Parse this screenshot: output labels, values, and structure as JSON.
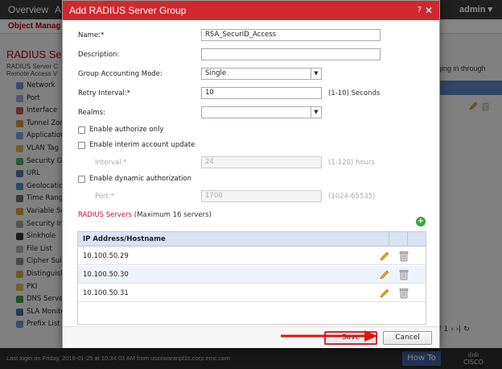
{
  "background": {
    "nav": [
      "Overview",
      "A"
    ],
    "admin": "admin ▾",
    "subnav": "Object Manag",
    "page_title": "RADIUS Ser",
    "page_sub_1": "RADIUS Server C",
    "page_sub_2": "Remote Access V",
    "right_text": "ogging in through",
    "pager": "of 1  ›  ›|  ↻",
    "sidebar": [
      {
        "label": "Network",
        "color": "#6b8fc9"
      },
      {
        "label": "Port",
        "color": "#8aa6d6"
      },
      {
        "label": "Interface",
        "color": "#c95050"
      },
      {
        "label": "Tunnel Zon",
        "color": "#d08a3a"
      },
      {
        "label": "Application",
        "color": "#7b9bd0"
      },
      {
        "label": "VLAN Tag",
        "color": "#d0b050"
      },
      {
        "label": "Security G",
        "color": "#5aa05a"
      },
      {
        "label": "URL",
        "color": "#4a70b0"
      },
      {
        "label": "Geolocation",
        "color": "#4a8fb0"
      },
      {
        "label": "Time Rang",
        "color": "#6a6a6a"
      },
      {
        "label": "Variable Se",
        "color": "#d09a30"
      },
      {
        "label": "Security In",
        "color": "#9a9a9a"
      },
      {
        "label": "Sinkhole",
        "color": "#333333"
      },
      {
        "label": "File List",
        "color": "#aaaaaa"
      },
      {
        "label": "Cipher Sui",
        "color": "#888888"
      },
      {
        "label": "Distinguish",
        "color": "#c8a040"
      },
      {
        "label": "PKI",
        "color": "#d0b060"
      },
      {
        "label": "DNS Serve",
        "color": "#4a8a4a"
      },
      {
        "label": "SLA Monito",
        "color": "#4a6aa0"
      },
      {
        "label": "Prefix List",
        "color": "#6a8ac0"
      }
    ],
    "footer": {
      "last_login": "Last login on Friday, 2019-01-25 at 10:34:03 AM from usxxwaranpl1c.corp.emc.com",
      "how_to": "How To",
      "cisco_top": "ılıılı",
      "cisco_bottom": "CISCO"
    }
  },
  "dialog": {
    "title": "Add RADIUS Server Group",
    "help": "?",
    "close": "✕",
    "fields": {
      "name_label": "Name:*",
      "name_value": "RSA_SecurID_Access",
      "description_label": "Description:",
      "description_value": "",
      "accounting_label": "Group Accounting Mode:",
      "accounting_value": "Single",
      "retry_label": "Retry Interval:*",
      "retry_value": "10",
      "retry_hint": "(1-10) Seconds",
      "realms_label": "Realms:",
      "realms_value": ""
    },
    "checkboxes": {
      "authorize_only": "Enable authorize only",
      "interim_update": "Enable interim account update",
      "dynamic_auth": "Enable dynamic authorization"
    },
    "disabled": {
      "interval_label": "Interval:*",
      "interval_value": "24",
      "interval_hint": "(1-120) hours",
      "port_label": "Port:*",
      "port_value": "1700",
      "port_hint": "(1024-65535)"
    },
    "servers": {
      "title_red": "RADIUS Servers",
      "title_rest": " (Maximum 16 servers)",
      "column": "IP Address/Hostname",
      "rows": [
        "10.100.50.29",
        "10.100.50.30",
        "10.100.50.31"
      ]
    },
    "buttons": {
      "save": "Save",
      "cancel": "Cancel"
    }
  }
}
